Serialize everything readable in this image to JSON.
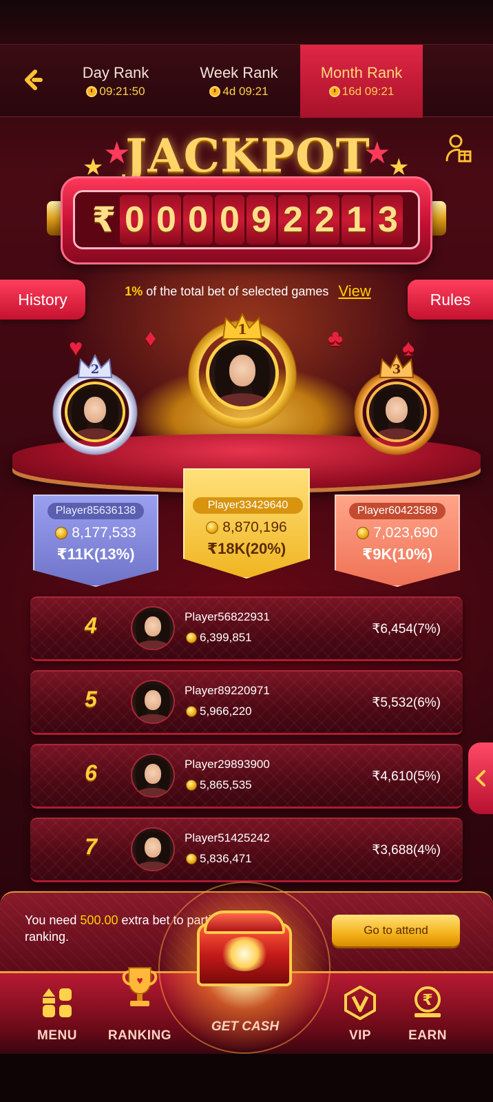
{
  "tabs": [
    {
      "label": "Day Rank",
      "timer": "09:21:50"
    },
    {
      "label": "Week Rank",
      "timer": "4d 09:21"
    },
    {
      "label": "Month Rank",
      "timer": "16d 09:21",
      "active": true
    }
  ],
  "jackpot": {
    "title": "JACKPOT",
    "currency": "₹",
    "digits": [
      "0",
      "0",
      "0",
      "0",
      "9",
      "2",
      "2",
      "1",
      "3"
    ]
  },
  "buttons": {
    "history": "History",
    "rules": "Rules"
  },
  "info": {
    "percent": "1%",
    "text": "of the total bet of selected games",
    "view": "View"
  },
  "podium": [
    {
      "rank": "2",
      "name": "Player85636138",
      "score": "8,177,533",
      "prize": "₹11K(13%)"
    },
    {
      "rank": "1",
      "name": "Player33429640",
      "score": "8,870,196",
      "prize": "₹18K(20%)"
    },
    {
      "rank": "3",
      "name": "Player60423589",
      "score": "7,023,690",
      "prize": "₹9K(10%)"
    }
  ],
  "rows": [
    {
      "rank": "4",
      "name": "Player56822931",
      "score": "6,399,851",
      "prize": "₹6,454(7%)"
    },
    {
      "rank": "5",
      "name": "Player89220971",
      "score": "5,966,220",
      "prize": "₹5,532(6%)"
    },
    {
      "rank": "6",
      "name": "Player29893900",
      "score": "5,865,535",
      "prize": "₹4,610(5%)"
    },
    {
      "rank": "7",
      "name": "Player51425242",
      "score": "5,836,471",
      "prize": "₹3,688(4%)"
    }
  ],
  "notice": {
    "pre": "You need ",
    "amount": "500.00",
    "post": " extra bet to participate in the ranking.",
    "button": "Go to attend"
  },
  "nav": [
    {
      "label": "MENU",
      "icon": "menu-grid-icon"
    },
    {
      "label": "RANKING",
      "icon": "trophy-icon"
    },
    {
      "label": "GET CASH",
      "icon": "treasure-chest-icon"
    },
    {
      "label": "VIP",
      "icon": "vip-shield-icon"
    },
    {
      "label": "EARN",
      "icon": "rupee-coin-icon"
    }
  ],
  "colors": {
    "accent_gold": "#ffd000",
    "accent_red": "#e02646",
    "card_silver": "#8a8fd8",
    "card_gold": "#f4c23a",
    "card_bronze": "#f07a5a"
  }
}
